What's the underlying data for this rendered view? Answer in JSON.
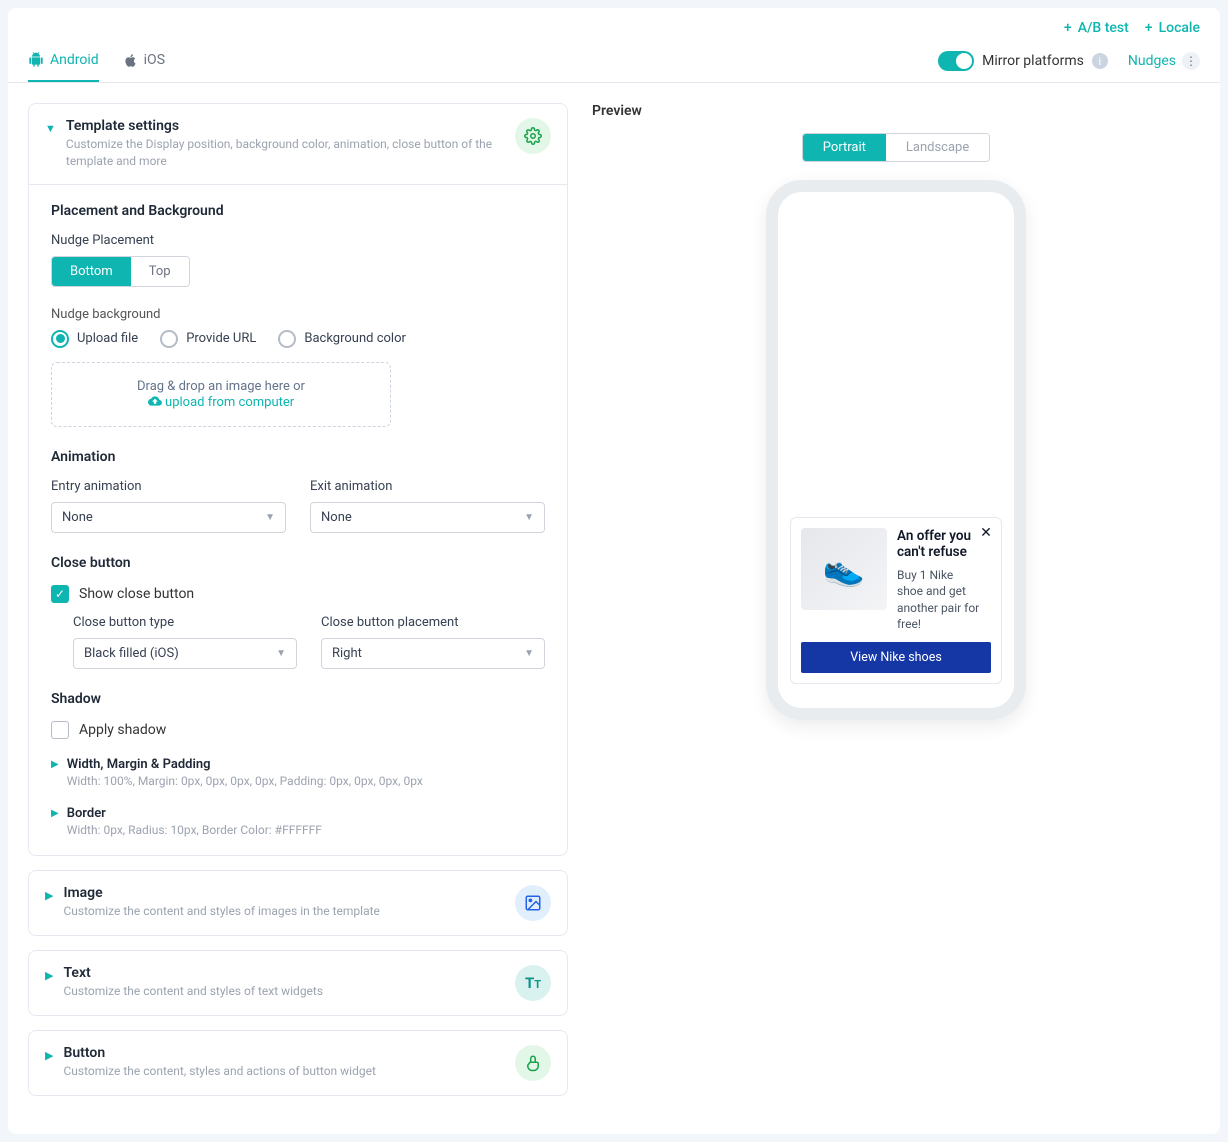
{
  "header": {
    "ab_test": "A/B test",
    "locale": "Locale",
    "mirror": "Mirror platforms",
    "nudges": "Nudges"
  },
  "tabs": {
    "android": "Android",
    "ios": "iOS"
  },
  "template_settings": {
    "title": "Template settings",
    "subtitle": "Customize the Display position, background color,  animation, close button of the template and more",
    "placement_bg": "Placement and Background",
    "nudge_placement_label": "Nudge Placement",
    "bottom": "Bottom",
    "top": "Top",
    "nudge_bg_label": "Nudge background",
    "bg_upload": "Upload file",
    "bg_url": "Provide URL",
    "bg_color": "Background color",
    "dropzone_text": "Drag & drop an image here or",
    "dropzone_link": "upload from computer",
    "animation": "Animation",
    "entry_anim": "Entry animation",
    "exit_anim": "Exit animation",
    "anim_none": "None",
    "close_btn": "Close button",
    "show_close": "Show close button",
    "close_type_label": "Close button type",
    "close_place_label": "Close button placement",
    "close_type_value": "Black filled (iOS)",
    "close_place_value": "Right",
    "shadow": "Shadow",
    "apply_shadow": "Apply shadow",
    "wmp_title": "Width, Margin & Padding",
    "wmp_sub": "Width: 100%, Margin: 0px, 0px, 0px, 0px, Padding: 0px, 0px, 0px, 0px",
    "border_title": "Border",
    "border_sub": "Width: 0px, Radius: 10px, Border Color: #FFFFFF"
  },
  "sections": {
    "image": {
      "title": "Image",
      "sub": "Customize the content and styles of images in the template"
    },
    "text": {
      "title": "Text",
      "sub": "Customize the content and styles of text widgets"
    },
    "button": {
      "title": "Button",
      "sub": "Customize the content, styles and actions of button widget"
    }
  },
  "preview": {
    "label": "Preview",
    "portrait": "Portrait",
    "landscape": "Landscape",
    "nudge_title": "An offer you can't refuse",
    "nudge_desc": "Buy 1 Nike shoe and get another pair for free!",
    "cta": "View Nike shoes"
  }
}
